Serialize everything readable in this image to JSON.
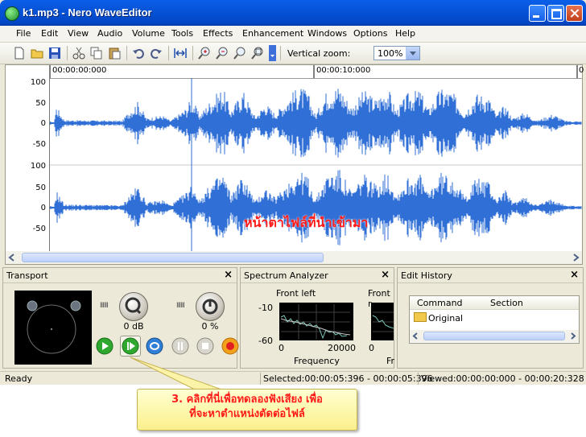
{
  "window": {
    "title": "k1.mp3 - Nero WaveEditor"
  },
  "menu": [
    "File",
    "Edit",
    "View",
    "Audio",
    "Volume",
    "Tools",
    "Effects",
    "Enhancement",
    "Windows",
    "Options",
    "Help"
  ],
  "toolbar": {
    "icons": [
      "new-icon",
      "open-icon",
      "save-icon",
      "cut-icon",
      "copy-icon",
      "paste-icon",
      "undo-icon",
      "redo-icon",
      "fit-icon",
      "zoom-in-icon",
      "zoom-out-icon",
      "zoom-selection-icon",
      "zoom-full-icon"
    ],
    "vertical_zoom_label": "Vertical zoom:",
    "vertical_zoom_value": "100%"
  },
  "timeline": {
    "start": "00:00:00:000",
    "mark": "00:00:10:000",
    "end_partial": "0"
  },
  "amplitude_scale": [
    "100",
    "50",
    "0",
    "-50",
    "100",
    "50",
    "0",
    "-50"
  ],
  "waveform_caption": "หน้าตาไฟล์ที่นำเข้ามา",
  "panels": {
    "transport": {
      "title": "Transport",
      "volume_value": "0 dB",
      "balance_value": "0 %",
      "buttons": [
        "play-button",
        "play-loop-button",
        "repeat-button",
        "pause-button",
        "stop-button",
        "record-button"
      ]
    },
    "spectrum": {
      "title": "Spectrum Analyzer",
      "channel_left": "Front left",
      "channel_right": "Front r",
      "y_top": "-10",
      "y_bottom": "-60",
      "x_start": "0",
      "x_end": "20000",
      "x_start_2": "0",
      "xlabel": "Frequency",
      "xlabel_2": "Fr"
    },
    "history": {
      "title": "Edit History",
      "columns": [
        "Command",
        "Section"
      ],
      "rows": [
        "Original"
      ]
    }
  },
  "status": {
    "state": "Ready",
    "selected": "Selected:00:00:05:396 - 00:00:05:396",
    "viewed": "Viewed:00:00:00:000 - 00:00:20:328"
  },
  "callout": {
    "line1": "3. คลิกที่นี่เพื่อทดลองฟังเสียง เพื่อ",
    "line2": "ที่จะหาตำแหน่งตัดต่อไฟล์"
  },
  "colors": {
    "waveform": "#2f6fd6",
    "caption": "#ff1a1a",
    "titlebar": "#0653d8"
  }
}
